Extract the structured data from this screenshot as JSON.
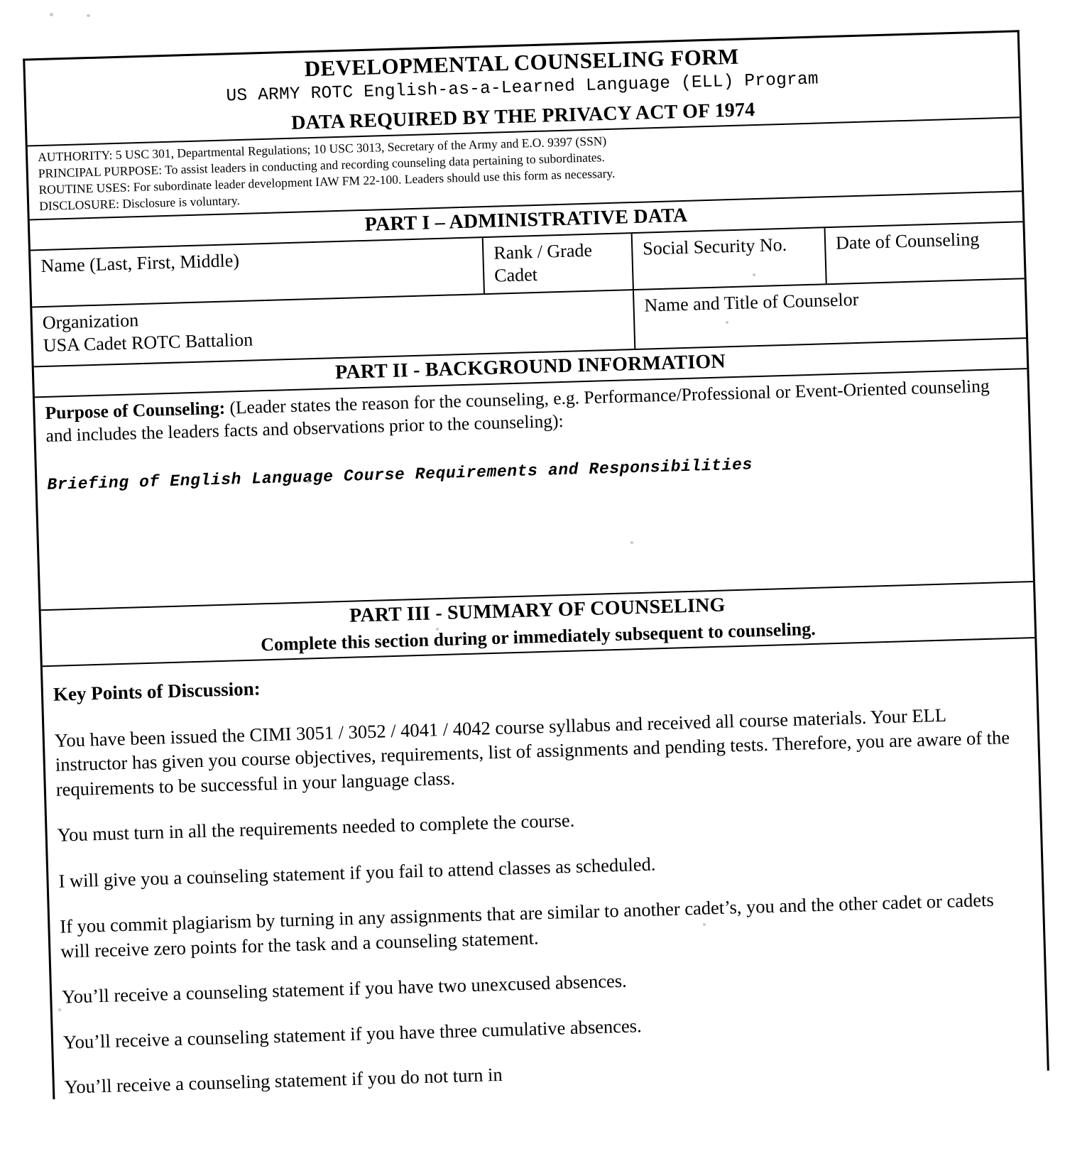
{
  "document": {
    "title": "DEVELOPMENTAL COUNSELING FORM",
    "subtitle": "US ARMY ROTC English-as-a-Learned Language (ELL) Program",
    "privacy_banner": "DATA REQUIRED BY THE PRIVACY ACT OF 1974"
  },
  "privacy_act": {
    "authority": "AUTHORITY: 5 USC 301, Departmental Regulations; 10 USC 3013, Secretary of the Army and E.O. 9397 (SSN)",
    "principal_purpose": "PRINCIPAL PURPOSE: To assist leaders in conducting and recording counseling data pertaining to subordinates.",
    "routine_uses": "ROUTINE USES: For subordinate leader development IAW FM 22-100.  Leaders should use this form as necessary.",
    "disclosure": "DISCLOSURE:  Disclosure is voluntary."
  },
  "part1": {
    "heading": "PART I – ADMINISTRATIVE DATA",
    "fields": {
      "name_label": "Name (Last, First, Middle)",
      "name_value": "",
      "rank_label": "Rank / Grade",
      "rank_value": "Cadet",
      "ssn_label": "Social Security No.",
      "ssn_value": "",
      "date_label": "Date of Counseling",
      "date_value": "",
      "organization_label": "Organization",
      "organization_value": "USA Cadet ROTC Battalion",
      "counselor_label": "Name and Title of Counselor",
      "counselor_value": ""
    }
  },
  "part2": {
    "heading": "PART II - BACKGROUND INFORMATION",
    "purpose_label": "Purpose of Counseling:",
    "purpose_instructions": "(Leader states the reason for the counseling, e.g. Performance/Professional or Event-Oriented counseling and includes the leaders facts and observations prior to the counseling):",
    "purpose_value": "Briefing of English Language Course Requirements and Responsibilities"
  },
  "part3": {
    "heading": "PART III - SUMMARY OF COUNSELING",
    "subheading": "Complete this section during or immediately subsequent to counseling.",
    "key_points_label": "Key Points of Discussion:",
    "paragraphs": [
      "You have been issued the CIMI 3051 / 3052 / 4041 / 4042 course syllabus and received all course materials.  Your ELL instructor has given you course objectives, requirements, list of assignments and pending tests.  Therefore, you are aware of the requirements to be successful in your language class.",
      "You must turn in all the requirements needed to complete the course.",
      "I will give you a counseling statement if you fail to attend classes as scheduled.",
      "If you commit plagiarism by turning in any assignments that are similar to another cadet’s, you and the other cadet or cadets will receive zero points for the task and a counseling statement.",
      "You’ll receive a counseling statement if you have two unexcused absences.",
      "You’ll receive a counseling statement if you have three cumulative absences."
    ],
    "clipped_paragraph": "You’ll receive a counseling statement if you do not turn in"
  }
}
